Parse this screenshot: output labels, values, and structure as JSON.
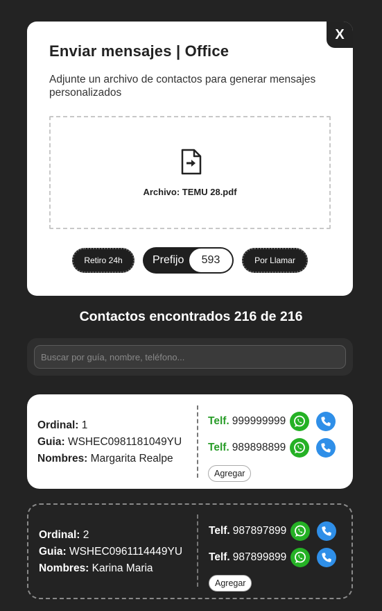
{
  "modal": {
    "title": "Enviar mensajes | Office",
    "subtitle": "Adjunte un archivo de contactos para generar mensajes personalizados",
    "close_label": "X",
    "file_name": "Archivo: TEMU 28.pdf"
  },
  "options": {
    "retiro_label": "Retiro 24h",
    "prefix_label": "Prefijo",
    "prefix_value": "593",
    "llamar_label": "Por Llamar"
  },
  "found_title": "Contactos encontrados 216 de 216",
  "search": {
    "placeholder": "Buscar por guía, nombre, teléfono..."
  },
  "labels": {
    "ordinal": "Ordinal:",
    "guia": "Guia:",
    "nombres": "Nombres:",
    "telf": "Telf.",
    "agregar": "Agregar"
  },
  "contacts": [
    {
      "ordinal": "1",
      "guia": "WSHEC0981181049YU",
      "nombres": "Margarita Realpe",
      "phones": [
        "999999999",
        "989898899"
      ]
    },
    {
      "ordinal": "2",
      "guia": "WSHEC0961114449YU",
      "nombres": "Karina Maria",
      "phones": [
        "987897899",
        "987899899"
      ]
    }
  ],
  "colors": {
    "background": "#232323",
    "whatsapp": "#25b125",
    "call": "#2f8fe8",
    "telf_green": "#2a9d2a"
  },
  "icons": [
    "file-import-icon",
    "whatsapp-icon",
    "phone-icon"
  ]
}
